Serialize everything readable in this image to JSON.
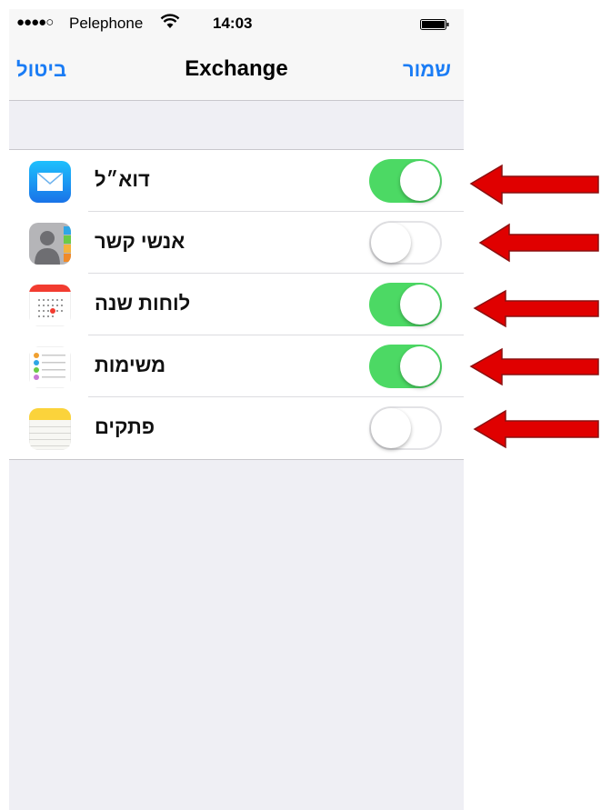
{
  "status_bar": {
    "signal_dots": "●●●●○",
    "carrier": "Pelephone",
    "time": "14:03",
    "wifi_icon": "wifi-icon",
    "battery_icon": "battery-icon"
  },
  "nav": {
    "left_label": "ביטול",
    "title": "Exchange",
    "right_label": "שמור"
  },
  "accent_color": "#1a7cf5",
  "toggle_on_color": "#4cd964",
  "rows": [
    {
      "label": "דוא״ל",
      "icon": "mail-icon",
      "enabled": true
    },
    {
      "label": "אנשי קשר",
      "icon": "contacts-icon",
      "enabled": false
    },
    {
      "label": "לוחות שנה",
      "icon": "calendar-icon",
      "enabled": true
    },
    {
      "label": "משימות",
      "icon": "reminders-icon",
      "enabled": true
    },
    {
      "label": "פתקים",
      "icon": "notes-icon",
      "enabled": false
    }
  ],
  "annotation_arrow_color": "#e00000"
}
